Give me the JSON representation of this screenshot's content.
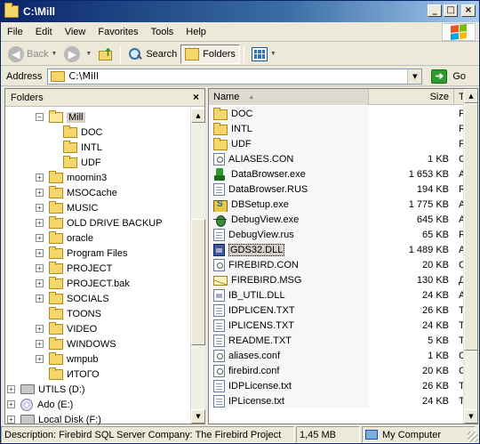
{
  "window": {
    "title": "C:\\Mill"
  },
  "title_buttons": {
    "minimize": "_",
    "maximize": "□",
    "close": "×"
  },
  "menu": [
    "File",
    "Edit",
    "View",
    "Favorites",
    "Tools",
    "Help"
  ],
  "toolbar": {
    "back": "Back",
    "search": "Search",
    "folders": "Folders"
  },
  "address": {
    "label": "Address",
    "value": "C:\\Mill",
    "go": "Go"
  },
  "folders_pane": {
    "title": "Folders",
    "close_glyph": "×",
    "tree": [
      {
        "label": "Mill",
        "expander": "−",
        "indent": 3,
        "open": true,
        "selected": true,
        "kind": "folder"
      },
      {
        "label": "DOC",
        "expander": "",
        "indent": 4,
        "kind": "folder"
      },
      {
        "label": "INTL",
        "expander": "",
        "indent": 4,
        "kind": "folder"
      },
      {
        "label": "UDF",
        "expander": "",
        "indent": 4,
        "kind": "folder"
      },
      {
        "label": "moomin3",
        "expander": "+",
        "indent": 3,
        "kind": "folder"
      },
      {
        "label": "MSOCache",
        "expander": "+",
        "indent": 3,
        "kind": "folder"
      },
      {
        "label": "MUSIC",
        "expander": "+",
        "indent": 3,
        "kind": "folder"
      },
      {
        "label": "OLD DRIVE BACKUP",
        "expander": "+",
        "indent": 3,
        "kind": "folder"
      },
      {
        "label": "oracle",
        "expander": "+",
        "indent": 3,
        "kind": "folder"
      },
      {
        "label": "Program Files",
        "expander": "+",
        "indent": 3,
        "kind": "folder"
      },
      {
        "label": "PROJECT",
        "expander": "+",
        "indent": 3,
        "kind": "folder"
      },
      {
        "label": "PROJECT.bak",
        "expander": "+",
        "indent": 3,
        "kind": "folder"
      },
      {
        "label": "SOCIALS",
        "expander": "+",
        "indent": 3,
        "kind": "folder"
      },
      {
        "label": "TOONS",
        "expander": "",
        "indent": 3,
        "kind": "folder"
      },
      {
        "label": "VIDEO",
        "expander": "+",
        "indent": 3,
        "kind": "folder"
      },
      {
        "label": "WINDOWS",
        "expander": "+",
        "indent": 3,
        "kind": "folder"
      },
      {
        "label": "wmpub",
        "expander": "+",
        "indent": 3,
        "kind": "folder"
      },
      {
        "label": "ИТОГО",
        "expander": "",
        "indent": 3,
        "kind": "folder"
      },
      {
        "label": "UTILS (D:)",
        "expander": "+",
        "indent": 1,
        "kind": "drive"
      },
      {
        "label": "Ado (E:)",
        "expander": "+",
        "indent": 1,
        "kind": "cd"
      },
      {
        "label": "Local Disk (F:)",
        "expander": "+",
        "indent": 1,
        "kind": "drive"
      }
    ]
  },
  "file_list": {
    "columns": {
      "name": "Name",
      "size": "Size",
      "type": "Type"
    },
    "rows": [
      {
        "name": "DOC",
        "size": "",
        "type": "File Folder",
        "icon": "folder"
      },
      {
        "name": "INTL",
        "size": "",
        "type": "File Folder",
        "icon": "folder"
      },
      {
        "name": "UDF",
        "size": "",
        "type": "File Folder",
        "icon": "folder"
      },
      {
        "name": "ALIASES.CON",
        "size": "1 KB",
        "type": "CON File",
        "icon": "cfg"
      },
      {
        "name": "DataBrowser.exe",
        "size": "1 653 KB",
        "type": "Application",
        "icon": "exe-green"
      },
      {
        "name": "DataBrowser.RUS",
        "size": "194 KB",
        "type": "RUS File",
        "icon": "doc"
      },
      {
        "name": "DBSetup.exe",
        "size": "1 775 KB",
        "type": "Application",
        "icon": "exe-setup"
      },
      {
        "name": "DebugView.exe",
        "size": "645 KB",
        "type": "Application",
        "icon": "exe-bug"
      },
      {
        "name": "DebugView.rus",
        "size": "65 KB",
        "type": "RUS File",
        "icon": "doc"
      },
      {
        "name": "GDS32.DLL",
        "size": "1 489 KB",
        "type": "Application Extension",
        "icon": "dll",
        "selected": true
      },
      {
        "name": "FIREBIRD.CON",
        "size": "20 KB",
        "type": "CON File",
        "icon": "cfg"
      },
      {
        "name": "FIREBIRD.MSG",
        "size": "130 KB",
        "type": "Документ",
        "icon": "msg"
      },
      {
        "name": "IB_UTIL.DLL",
        "size": "24 KB",
        "type": "Application Extension",
        "icon": "dll"
      },
      {
        "name": "IDPLICEN.TXT",
        "size": "26 KB",
        "type": "Text Document",
        "icon": "doc"
      },
      {
        "name": "IPLICENS.TXT",
        "size": "24 KB",
        "type": "Text Document",
        "icon": "doc"
      },
      {
        "name": "README.TXT",
        "size": "5 KB",
        "type": "Text Document",
        "icon": "doc"
      },
      {
        "name": "aliases.conf",
        "size": "1 KB",
        "type": "CONF File",
        "icon": "cfg"
      },
      {
        "name": "firebird.conf",
        "size": "20 KB",
        "type": "CONF File",
        "icon": "cfg"
      },
      {
        "name": "IDPLicense.txt",
        "size": "26 KB",
        "type": "Text Document",
        "icon": "doc"
      },
      {
        "name": "IPLicense.txt",
        "size": "24 KB",
        "type": "Text Document",
        "icon": "doc"
      }
    ]
  },
  "status": {
    "description": "Description: Firebird SQL Server Company: The Firebird Project",
    "size": "1,45 MB",
    "zone": "My Computer"
  },
  "colors": {
    "title_bar": "#0a246a",
    "selection": "#d4d0c8",
    "folder": "#f5d66b"
  }
}
